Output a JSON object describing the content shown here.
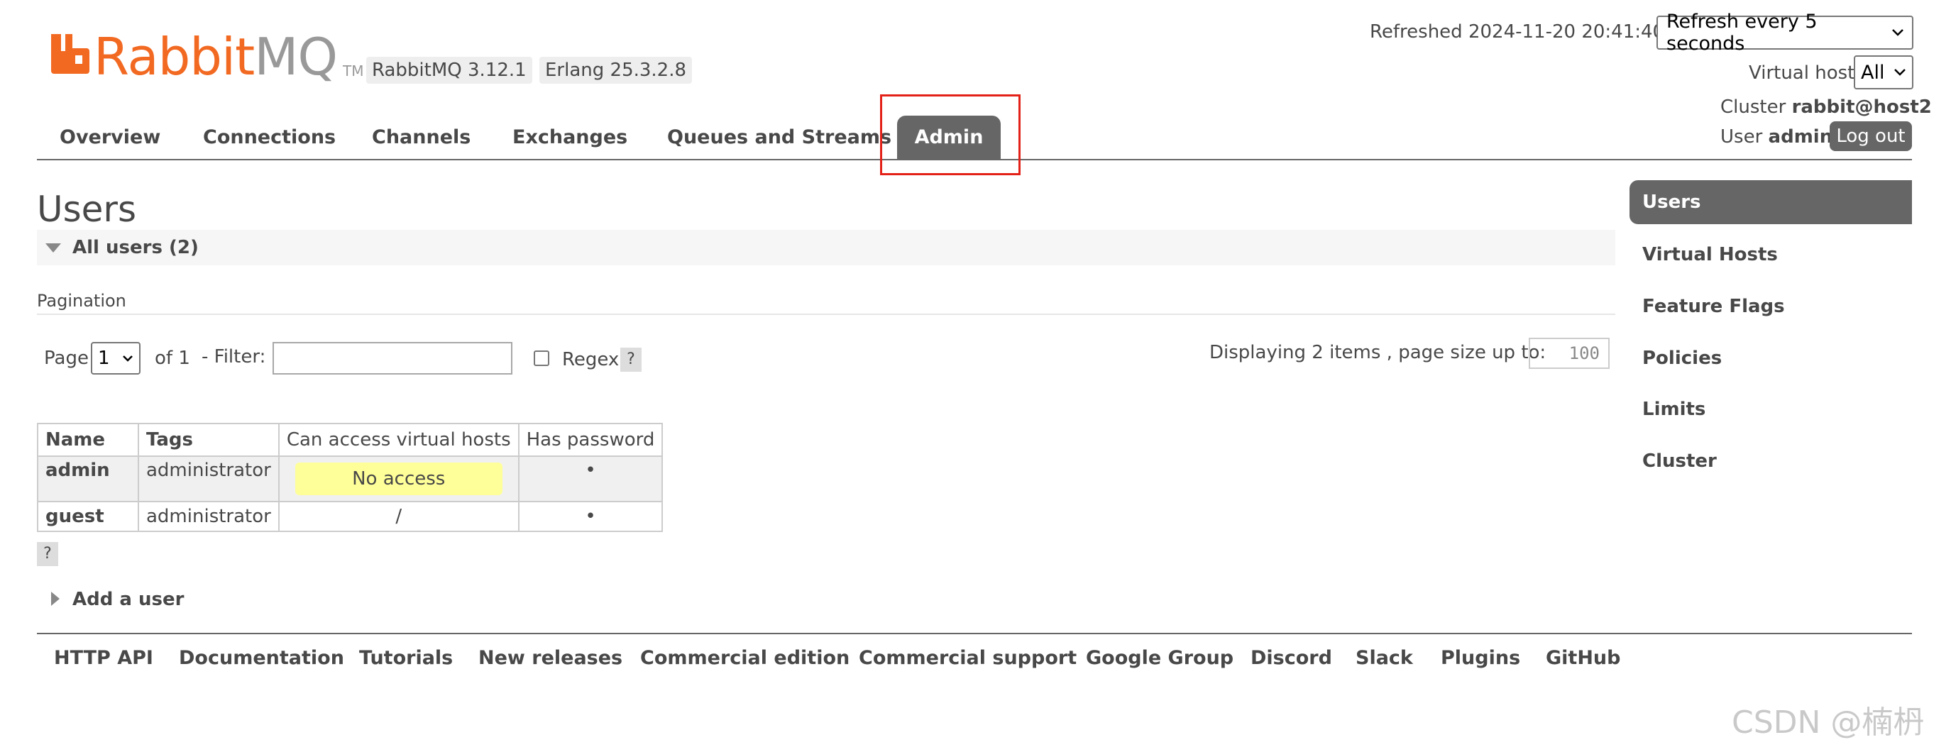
{
  "header": {
    "logo_rabbit": "Rabbit",
    "logo_mq": "MQ",
    "logo_tm": "TM",
    "rabbitmq_version": "RabbitMQ 3.12.1",
    "erlang_version": "Erlang 25.3.2.8",
    "refreshed_label": "Refreshed 2024-11-20 20:41:40",
    "refresh_select": "Refresh every 5 seconds",
    "virtual_host_label": "Virtual host",
    "virtual_host_select": "All",
    "cluster_label": "Cluster",
    "cluster_name": "rabbit@host2",
    "user_label": "User",
    "user_name": "admin",
    "logout_label": "Log out"
  },
  "nav": {
    "tabs": [
      "Overview",
      "Connections",
      "Channels",
      "Exchanges",
      "Queues and Streams",
      "Admin"
    ],
    "active": "Admin"
  },
  "sidebar": {
    "items": [
      "Users",
      "Virtual Hosts",
      "Feature Flags",
      "Policies",
      "Limits",
      "Cluster"
    ],
    "active": "Users"
  },
  "main": {
    "title": "Users",
    "section_title": "All users (2)",
    "pagination_label": "Pagination",
    "page_label": "Page",
    "page_select": "1",
    "of_label": "of 1",
    "filter_label": "- Filter:",
    "filter_value": "",
    "regex_label": "Regex",
    "help_label": "?",
    "displaying_label": "Displaying 2 items , page size up to:",
    "page_size_value": "100",
    "add_user_label": "Add a user"
  },
  "table": {
    "headers": [
      "Name",
      "Tags",
      "Can access virtual hosts",
      "Has password"
    ],
    "rows": [
      {
        "name": "admin",
        "tags": "administrator",
        "vhosts": "No access",
        "has_password": "•"
      },
      {
        "name": "guest",
        "tags": "administrator",
        "vhosts": "/",
        "has_password": "•"
      }
    ]
  },
  "footer": {
    "links": [
      "HTTP API",
      "Documentation",
      "Tutorials",
      "New releases",
      "Commercial edition",
      "Commercial support",
      "Google Group",
      "Discord",
      "Slack",
      "Plugins",
      "GitHub"
    ]
  },
  "watermark": "CSDN @楠枬",
  "colors": {
    "brand_orange": "#f26922",
    "tab_active": "#666666",
    "no_access_bg": "#ffff99",
    "highlight_box": "#e32118"
  }
}
